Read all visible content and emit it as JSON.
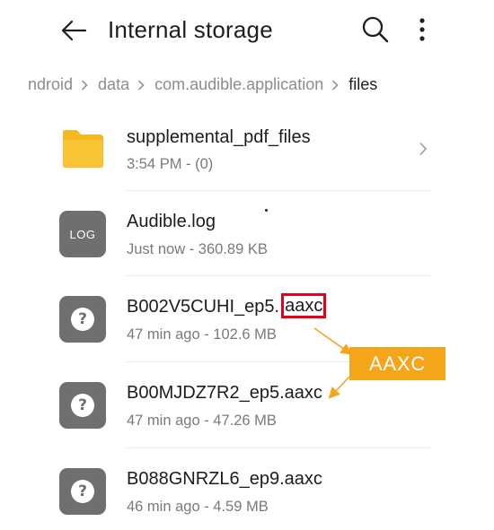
{
  "header": {
    "title": "Internal storage",
    "back_icon": "arrow-left-icon",
    "search_icon": "search-icon",
    "more_icon": "more-vertical-icon"
  },
  "breadcrumb": {
    "items": [
      "Android",
      "data",
      "com.audible.application",
      "files"
    ],
    "visible_first": "ndroid",
    "separator_icon": "chevron-right-icon"
  },
  "files": [
    {
      "name": "supplemental_pdf_files",
      "meta": "3:54 PM - (0)",
      "type": "folder",
      "icon": "folder-icon"
    },
    {
      "name": "Audible.log",
      "meta": "Just now - 360.89 KB",
      "type": "log",
      "icon": "log-icon",
      "icon_label": "LOG"
    },
    {
      "name_prefix": "B002V5CUHI_ep5.",
      "name_ext": "aaxc",
      "meta": "47 min ago - 102.6 MB",
      "type": "unknown",
      "icon": "question-file-icon"
    },
    {
      "name": "B00MJDZ7R2_ep5.aaxc",
      "meta": "47 min ago - 47.26 MB",
      "type": "unknown",
      "icon": "question-file-icon"
    },
    {
      "name": "B088GNRZL6_ep9.aaxc",
      "meta": "46 min ago - 4.59 MB",
      "type": "unknown",
      "icon": "question-file-icon"
    }
  ],
  "annotation": {
    "label": "AAXC",
    "color": "#f5a51a",
    "highlight_color": "#e3001b"
  },
  "colors": {
    "folder": "#f6b81f",
    "file_icon": "#6f6f6f"
  }
}
